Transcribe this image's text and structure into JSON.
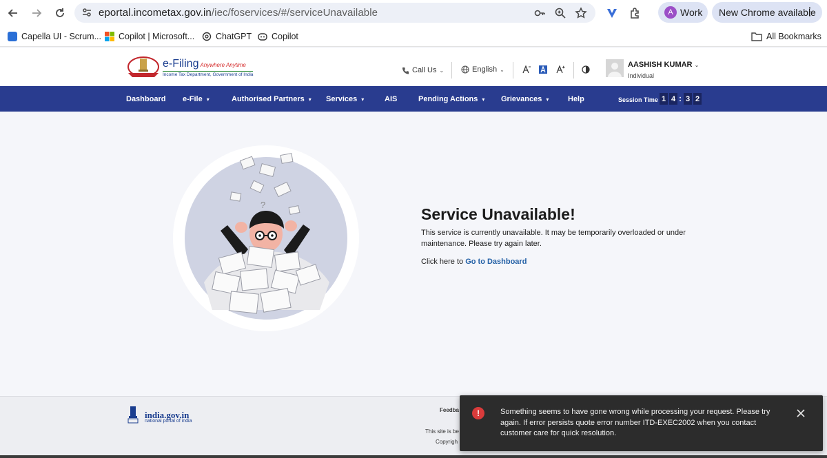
{
  "browser": {
    "url_host": "eportal.incometax.gov.in",
    "url_path": "/iec/foservices/#/serviceUnavailable",
    "profile_initial": "A",
    "profile_label": "Work",
    "update_label": "New Chrome available",
    "bookmarks": [
      {
        "label": "Capella UI - Scrum..."
      },
      {
        "label": "Copilot | Microsoft..."
      },
      {
        "label": "ChatGPT"
      },
      {
        "label": "Copilot"
      }
    ],
    "all_bookmarks_label": "All Bookmarks"
  },
  "header": {
    "brand_title": "e-Filing",
    "brand_tagline": "Anywhere Anytime",
    "brand_sub": "Income Tax Department, Government of India",
    "call_us": "Call Us",
    "language": "English",
    "user_name": "AASHISH KUMAR",
    "user_role": "Individual"
  },
  "nav": {
    "items": [
      {
        "label": "Dashboard"
      },
      {
        "label": "e-File"
      },
      {
        "label": "Authorised Partners"
      },
      {
        "label": "Services"
      },
      {
        "label": "AIS"
      },
      {
        "label": "Pending Actions"
      },
      {
        "label": "Grievances"
      },
      {
        "label": "Help"
      }
    ],
    "session_label": "Session Time",
    "session_digits": [
      "1",
      "4",
      "3",
      "2"
    ]
  },
  "main": {
    "title": "Service Unavailable!",
    "body": "This service is currently unavailable. It may be temporarily overloaded or under maintenance. Please try again later.",
    "link_prefix": "Click here to",
    "link_label": "Go to Dashboard"
  },
  "footer": {
    "india_gov": "india.gov.in",
    "india_sub": "national portal of india",
    "feedback": "Feedba",
    "site_line": "This site is be",
    "copyright": "Copyrigh"
  },
  "toast": {
    "message": "Something seems to have gone wrong while processing your request. Please try again. If error persists quote error number ITD-EXEC2002 when you contact customer care for quick resolution."
  },
  "colors": {
    "nav_blue": "#293c8f",
    "link_blue": "#2360a6",
    "error_red": "#d93b3b",
    "toast_bg": "#2c2c2c"
  }
}
